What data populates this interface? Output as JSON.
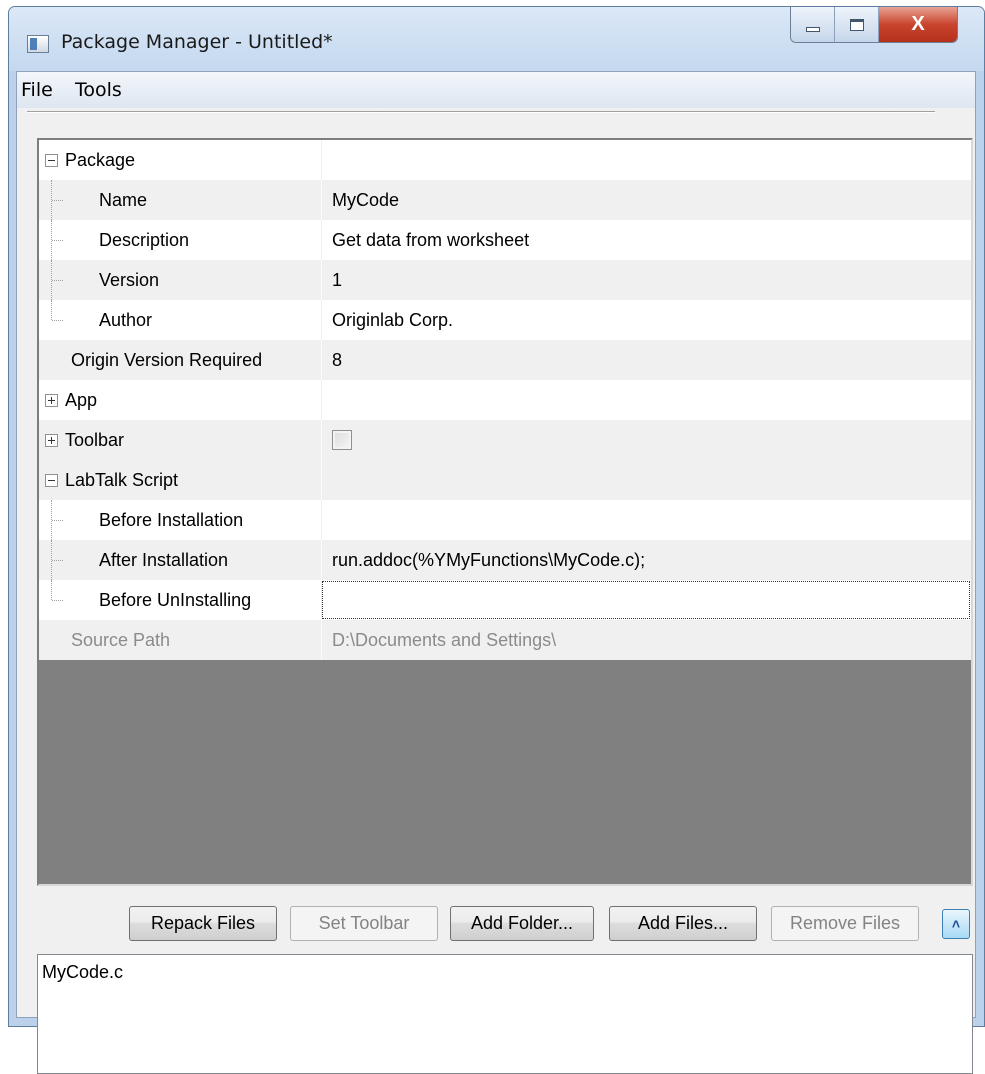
{
  "window": {
    "title": "Package Manager - Untitled*",
    "close_glyph": "X"
  },
  "menu": {
    "items": [
      "File",
      "Tools"
    ]
  },
  "properties": {
    "package_label": "Package",
    "name_label": "Name",
    "name_value": "MyCode",
    "description_label": "Description",
    "description_value": "Get data from worksheet",
    "version_label": "Version",
    "version_value": "1",
    "author_label": "Author",
    "author_value": "Originlab Corp.",
    "origin_version_label": "Origin Version Required",
    "origin_version_value": "8",
    "app_label": "App",
    "toolbar_label": "Toolbar",
    "toolbar_checked": false,
    "labtalk_label": "LabTalk Script",
    "before_install_label": "Before Installation",
    "before_install_value": "",
    "after_install_label": "After Installation",
    "after_install_value": "run.addoc(%YMyFunctions\\MyCode.c);",
    "before_uninstall_label": "Before UnInstalling",
    "before_uninstall_value": "",
    "source_path_label": "Source Path",
    "source_path_value": "D:\\Documents and Settings\\"
  },
  "buttons": {
    "repack": "Repack Files",
    "set_toolbar": "Set Toolbar",
    "add_folder": "Add Folder...",
    "add_files": "Add Files...",
    "remove_files": "Remove Files",
    "collapse_glyph": "˄"
  },
  "files": [
    "MyCode.c"
  ]
}
